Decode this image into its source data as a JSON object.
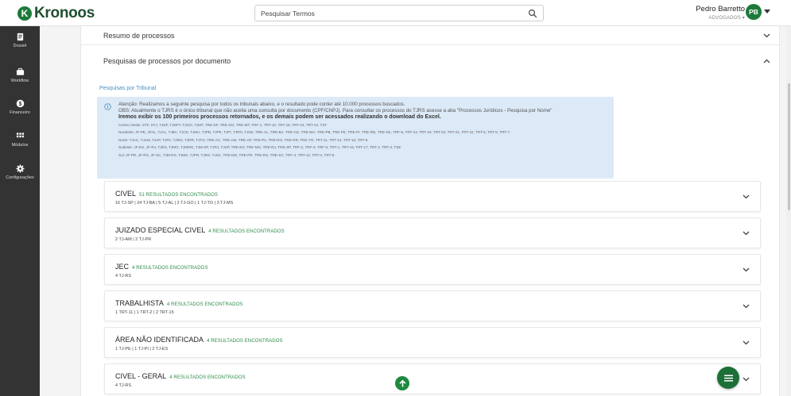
{
  "app": {
    "name": "Kronoos",
    "logo_letter": "K",
    "brand_color": "#1d7a3a"
  },
  "search": {
    "placeholder": "Pesquisar Termos",
    "value": ""
  },
  "user": {
    "name": "Pedro Barretto",
    "role": "ADVOGADOS",
    "initials": "PB"
  },
  "sidebar": {
    "items": [
      {
        "label": "Dossiê",
        "icon": "dossier-icon"
      },
      {
        "label": "Workflow",
        "icon": "briefcase-icon"
      },
      {
        "label": "Financeiro",
        "icon": "dollar-icon"
      },
      {
        "label": "Módulos",
        "icon": "grid-icon"
      },
      {
        "label": "Configurações",
        "icon": "gear-icon"
      }
    ]
  },
  "sections": {
    "resumo": {
      "title": "Resumo de processos",
      "expanded": false
    },
    "pesquisas": {
      "title": "Pesquisas de processos por documento",
      "expanded": true,
      "subtitle": "Pesquisas por Tribunal"
    }
  },
  "info": {
    "line1": "Atenção: Realizamos a seguinte pesquisa por todos os tribunais abaixo, e o resultado pode conter até 10.000 processos buscados.",
    "line2": "OBS: Atualmente o TJRS é o único tribunal que não aceita uma consulta por documento (CPF/CNPJ). Para consultar os processos do TJRS acesse a aba \"Processos Jurídicos - Pesquisa por Nome\"",
    "line3": "Iremos exibir os 100 primeiros processos retornados, e os demais podem ser acessados realizando o download do Excel.",
    "regions": [
      "Centro Oeste: STF, STJ, TJDF, TJDFT, TJGO, TJMT, TRE-DF, TRE-GO, TRE-MT, TRF-1, TRT-10, TRT-18, TRT-23, TRT-24, TST.",
      "Nordeste: JF-PE, JFAL, TJAL, TJBA, TJCE, TJMA, TJPB, TJPE, TJPI, TJRN, TJSE, TRE-AL, TRE-BA, TRE-CE, TRE-MA, TRE-PB, TRE-PE, TRE-PI, TRE-RN, TRE-SE, TRF-5, TRT-13, TRT-19, TRT-20, TRT-21, TRT-22, TRT-5, TRT-6, TRT-7.",
      "Norte: TJAC, TJAM, TJAP, TJPA, TJRO, TJRR, TJTO, TRE-AC, TRE-AM, TRE-AP, TRE-PA, TRE-RO, TRE-RR, TRE-TO, TRT-11, TRT-14, TRT-16, TRT-8.",
      "Sudeste: JF-ES, JF-RJ, TJES, TJMG, TJMMG, TJM-SP, TJRJ, TJSP, TRE-ES, TRE-MG, TRE-RJ, TRE-SP, TRF-2, TRF-3, TRF-6, TRT-1, TRT-15, TRT-17, TRT-2, TRT-3, TSE",
      "Sul: JF-PR, JF-RS, JF-SC, TJM-RS, TJMS, TJPR, TJRS, TJSC, TRE-MS, TRE-PR, TRE-RS, TRE-SC, TRF-4, TRT-12, TRT-4, TRT-9."
    ]
  },
  "results": [
    {
      "title": "CIVEL",
      "count": "51 RESULTADOS ENCONTRADOS",
      "courts": "16 TJ-SP | 24 TJ-BA | 5 TJ-AL | 2 TJ-GO | 1 TJ-TO | 3 TJ-MS"
    },
    {
      "title": "JUIZADO ESPECIAL CIVEL",
      "count": "4 RESULTADOS ENCONTRADOS",
      "courts": "2 TJ-AM | 2 TJ-PR"
    },
    {
      "title": "JEC",
      "count": "4 RESULTADOS ENCONTRADOS",
      "courts": "4 TJ-RS"
    },
    {
      "title": "TRABALHISTA",
      "count": "4 RESULTADOS ENCONTRADOS",
      "courts": "1 TRT-11 | 1 TRT-2 | 2 TRT-15"
    },
    {
      "title": "ÁREA NÃO IDENTIFICADA",
      "count": "4 RESULTADOS ENCONTRADOS",
      "courts": "1 TJ-PE | 1 TJ-PI | 2 TJ-ES"
    },
    {
      "title": "CIVEL - GERAL",
      "count": "4 RESULTADOS ENCONTRADOS",
      "courts": "4 TJ-RS"
    }
  ],
  "actions": {
    "scroll_top_icon": "arrow-up-icon",
    "menu_icon": "menu-icon"
  }
}
